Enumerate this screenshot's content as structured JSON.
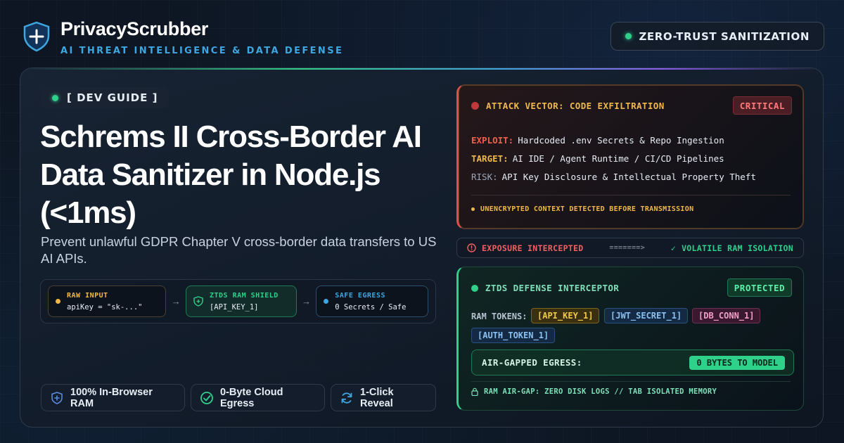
{
  "brand": {
    "name": "PrivacyScrubber",
    "tagline": "AI THREAT INTELLIGENCE & DATA DEFENSE",
    "icon": "shield-plus-icon"
  },
  "status_pill": "ZERO-TRUST SANITIZATION",
  "hero": {
    "kicker": "[ DEV GUIDE ]",
    "headline": "Schrems II Cross-Border AI Data Sanitizer in Node.js (<1ms)",
    "subtitle": "Prevent unlawful GDPR Chapter V cross-border data transfers to US AI APIs."
  },
  "pipeline": {
    "raw": {
      "label": "RAW INPUT",
      "value": "apiKey = \"sk-...\""
    },
    "shield": {
      "label": "ZTDS RAM SHIELD",
      "value": "[API_KEY_1]"
    },
    "safe": {
      "label": "SAFE EGRESS",
      "value": "0 Secrets / Safe"
    },
    "arrow": "→"
  },
  "features": [
    {
      "label": "100% In-Browser RAM",
      "icon": "shield-plus-icon"
    },
    {
      "label": "0-Byte Cloud Egress",
      "icon": "check-circle-icon"
    },
    {
      "label": "1-Click Reveal",
      "icon": "refresh-icon"
    }
  ],
  "attack": {
    "title": "ATTACK VECTOR: CODE EXFILTRATION",
    "badge": "CRITICAL",
    "exploit_key": "EXPLOIT:",
    "exploit_val": "Hardcoded .env Secrets & Repo Ingestion",
    "target_key": "TARGET:",
    "target_val": "AI IDE / Agent Runtime / CI/CD Pipelines",
    "risk_key": "RISK:",
    "risk_val": "API Key Disclosure & Intellectual Property Theft",
    "footer": "UNENCRYPTED CONTEXT DETECTED BEFORE TRANSMISSION"
  },
  "intercept": {
    "left": "EXPOSURE INTERCEPTED",
    "mid": "=======>",
    "right": "VOLATILE RAM ISOLATION"
  },
  "defense": {
    "title": "ZTDS DEFENSE INTERCEPTOR",
    "badge": "PROTECTED",
    "tokens_label": "RAM TOKENS:",
    "tokens": [
      "[API_KEY_1]",
      "[JWT_SECRET_1]",
      "[DB_CONN_1]",
      "[AUTH_TOKEN_1]"
    ],
    "egress_label": "AIR-GAPPED EGRESS:",
    "egress_value": "0 BYTES TO MODEL",
    "footer": "RAM AIR-GAP: ZERO DISK LOGS // TAB ISOLATED MEMORY"
  },
  "colors": {
    "accent_green": "#2fd08a",
    "accent_blue": "#3ea6e0",
    "warning_amber": "#f0b84a",
    "critical_red": "#e0504a"
  }
}
